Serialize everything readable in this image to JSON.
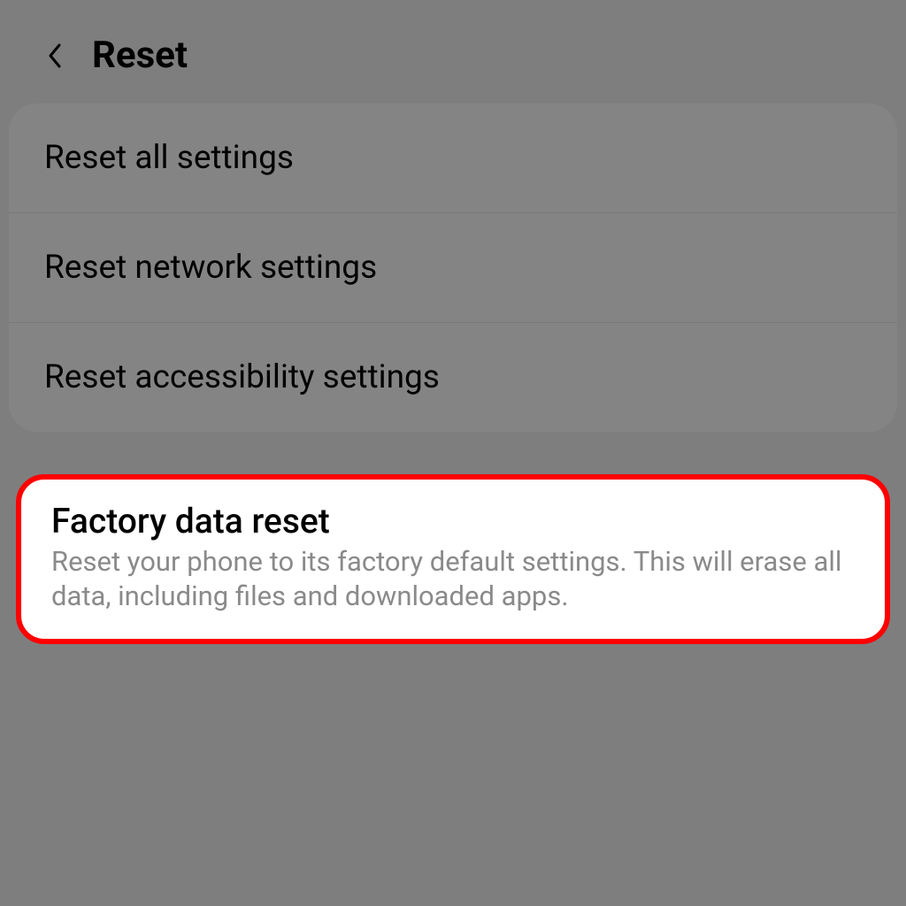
{
  "header": {
    "title": "Reset"
  },
  "resetOptions": {
    "items": [
      {
        "label": "Reset all settings"
      },
      {
        "label": "Reset network settings"
      },
      {
        "label": "Reset accessibility settings"
      }
    ]
  },
  "factoryReset": {
    "title": "Factory data reset",
    "description": "Reset your phone to its factory default settings. This will erase all data, including files and downloaded apps."
  }
}
